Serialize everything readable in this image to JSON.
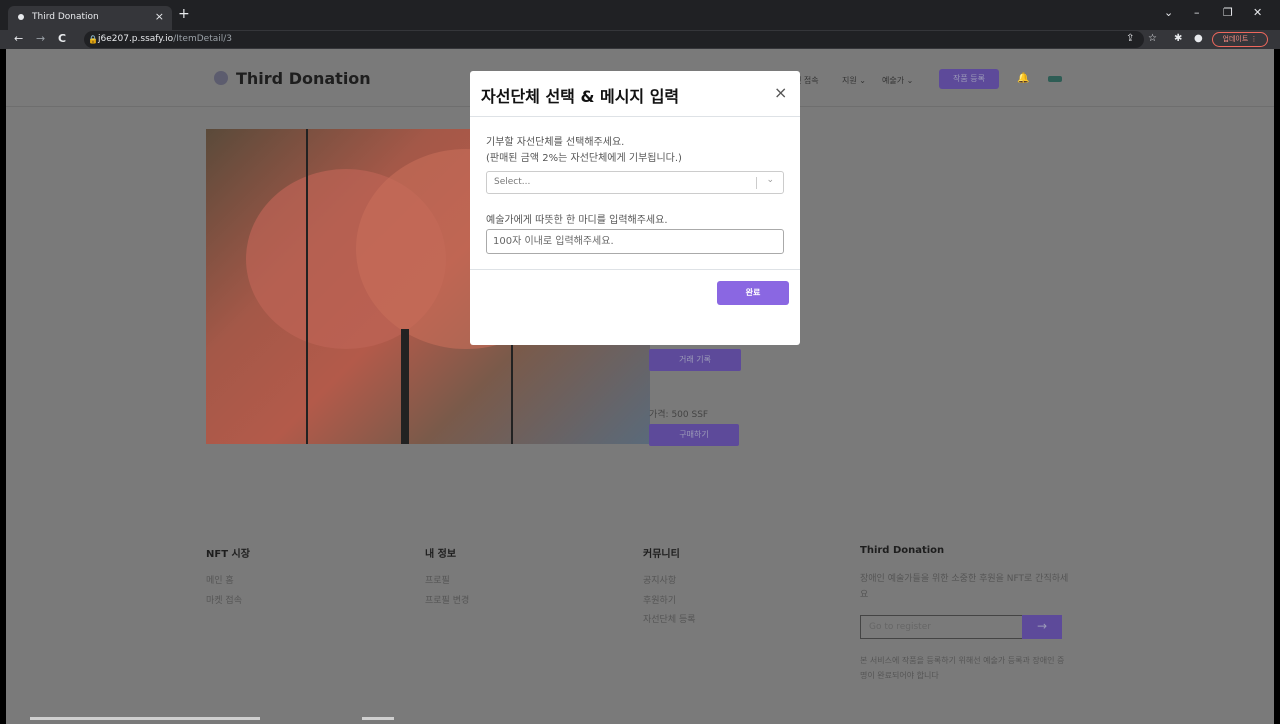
{
  "browser": {
    "tab_title": "Third Donation",
    "tab_close": "×",
    "new_tab": "+",
    "controls": {
      "dropdown": "⌄",
      "minimize": "–",
      "restore": "❐",
      "close": "✕"
    },
    "nav": {
      "back": "←",
      "forward": "→",
      "reload": "C"
    },
    "url_host": "j6e207.p.ssafy.io",
    "url_path": "/ItemDetail/3",
    "update_label": "업데이트 ⋮"
  },
  "header": {
    "logo": "Third Donation",
    "nav_items": [
      "켓 접속",
      "지원 ⌄",
      "예술가 ⌄"
    ],
    "register_button": "작품 등록"
  },
  "item": {
    "history_button": "거래 기록",
    "price": "가격: 500 SSF",
    "buy_button": "구매하기"
  },
  "footer": {
    "market": {
      "title": "NFT 시장",
      "links": [
        "메인 홈",
        "마켓 접속"
      ]
    },
    "my_info": {
      "title": "내 정보",
      "links": [
        "프로필",
        "프로필 변경"
      ]
    },
    "community": {
      "title": "커뮤니티",
      "links": [
        "공지사항",
        "후원하기",
        "자선단체 등록"
      ]
    },
    "about": {
      "title": "Third Donation",
      "description": "장애인 예술가들을 위한 소중한 후원을 NFT로 간직하세요",
      "register_placeholder": "Go to register",
      "register_arrow": "→",
      "note": "본 서비스에 작품을 등록하기 위해선 예술가 등록과 장애인 증명이 완료되어야 합니다"
    }
  },
  "modal": {
    "title": "자선단체 선택 & 메시지 입력",
    "close": "×",
    "select_label_line1": "기부할 자선단체를 선택해주세요.",
    "select_label_line2": "(판매된 금액 2%는 자선단체에게 기부됩니다.)",
    "select_placeholder": "Select...",
    "select_arrow": "⌄",
    "message_label": "예술가에게 따뜻한 한 마디를 입력해주세요.",
    "message_placeholder": "100자 이내로 입력해주세요.",
    "done_button": "완료"
  }
}
